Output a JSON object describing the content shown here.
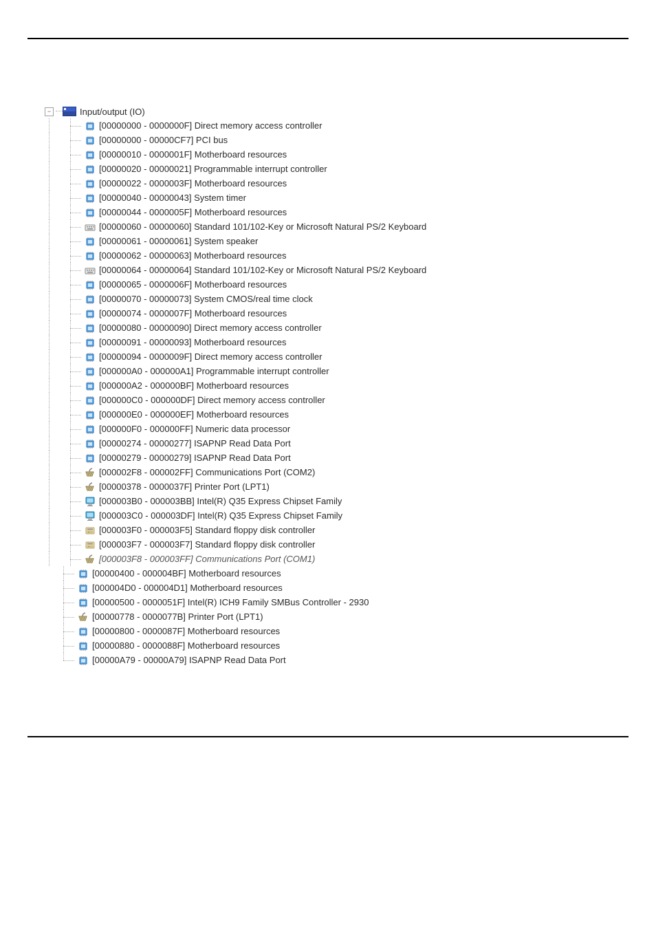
{
  "root_label": "Input/output (IO)",
  "items": [
    {
      "type": "chip",
      "range": "[00000000 - 0000000F]",
      "label": "Direct memory access controller"
    },
    {
      "type": "chip",
      "range": "[00000000 - 00000CF7]",
      "label": "PCI bus"
    },
    {
      "type": "chip",
      "range": "[00000010 - 0000001F]",
      "label": "Motherboard resources"
    },
    {
      "type": "chip",
      "range": "[00000020 - 00000021]",
      "label": "Programmable interrupt controller"
    },
    {
      "type": "chip",
      "range": "[00000022 - 0000003F]",
      "label": "Motherboard resources"
    },
    {
      "type": "chip",
      "range": "[00000040 - 00000043]",
      "label": "System timer"
    },
    {
      "type": "chip",
      "range": "[00000044 - 0000005F]",
      "label": "Motherboard resources"
    },
    {
      "type": "keyboard",
      "range": "[00000060 - 00000060]",
      "label": "Standard 101/102-Key or Microsoft Natural PS/2 Keyboard"
    },
    {
      "type": "chip",
      "range": "[00000061 - 00000061]",
      "label": "System speaker"
    },
    {
      "type": "chip",
      "range": "[00000062 - 00000063]",
      "label": "Motherboard resources"
    },
    {
      "type": "keyboard",
      "range": "[00000064 - 00000064]",
      "label": "Standard 101/102-Key or Microsoft Natural PS/2 Keyboard"
    },
    {
      "type": "chip",
      "range": "[00000065 - 0000006F]",
      "label": "Motherboard resources"
    },
    {
      "type": "chip",
      "range": "[00000070 - 00000073]",
      "label": "System CMOS/real time clock"
    },
    {
      "type": "chip",
      "range": "[00000074 - 0000007F]",
      "label": "Motherboard resources"
    },
    {
      "type": "chip",
      "range": "[00000080 - 00000090]",
      "label": "Direct memory access controller"
    },
    {
      "type": "chip",
      "range": "[00000091 - 00000093]",
      "label": "Motherboard resources"
    },
    {
      "type": "chip",
      "range": "[00000094 - 0000009F]",
      "label": "Direct memory access controller"
    },
    {
      "type": "chip",
      "range": "[000000A0 - 000000A1]",
      "label": "Programmable interrupt controller"
    },
    {
      "type": "chip",
      "range": "[000000A2 - 000000BF]",
      "label": "Motherboard resources"
    },
    {
      "type": "chip",
      "range": "[000000C0 - 000000DF]",
      "label": "Direct memory access controller"
    },
    {
      "type": "chip",
      "range": "[000000E0 - 000000EF]",
      "label": "Motherboard resources"
    },
    {
      "type": "chip",
      "range": "[000000F0 - 000000FF]",
      "label": "Numeric data processor"
    },
    {
      "type": "chip",
      "range": "[00000274 - 00000277]",
      "label": "ISAPNP Read Data Port"
    },
    {
      "type": "chip",
      "range": "[00000279 - 00000279]",
      "label": "ISAPNP Read Data Port"
    },
    {
      "type": "port",
      "range": "[000002F8 - 000002FF]",
      "label": "Communications Port (COM2)"
    },
    {
      "type": "port",
      "range": "[00000378 - 0000037F]",
      "label": "Printer Port (LPT1)"
    },
    {
      "type": "display",
      "range": "[000003B0 - 000003BB]",
      "label": "Intel(R) Q35 Express Chipset Family"
    },
    {
      "type": "display",
      "range": "[000003C0 - 000003DF]",
      "label": "Intel(R) Q35 Express Chipset Family"
    },
    {
      "type": "floppy",
      "range": "[000003F0 - 000003F5]",
      "label": "Standard floppy disk controller"
    },
    {
      "type": "floppy",
      "range": "[000003F7 - 000003F7]",
      "label": "Standard floppy disk controller"
    },
    {
      "type": "port",
      "range": "[000003F8 - 000003FF]",
      "label": "Communications Port (COM1)",
      "italic": true
    }
  ],
  "items2": [
    {
      "type": "chip",
      "range": "[00000400 - 000004BF]",
      "label": "Motherboard resources"
    },
    {
      "type": "chip",
      "range": "[000004D0 - 000004D1]",
      "label": "Motherboard resources"
    },
    {
      "type": "chip",
      "range": "[00000500 - 0000051F]",
      "label": "Intel(R) ICH9 Family SMBus Controller - 2930"
    },
    {
      "type": "port",
      "range": "[00000778 - 0000077B]",
      "label": "Printer Port (LPT1)"
    },
    {
      "type": "chip",
      "range": "[00000800 - 0000087F]",
      "label": "Motherboard resources"
    },
    {
      "type": "chip",
      "range": "[00000880 - 0000088F]",
      "label": "Motherboard resources"
    },
    {
      "type": "chip",
      "range": "[00000A79 - 00000A79]",
      "label": "ISAPNP Read Data Port"
    }
  ]
}
